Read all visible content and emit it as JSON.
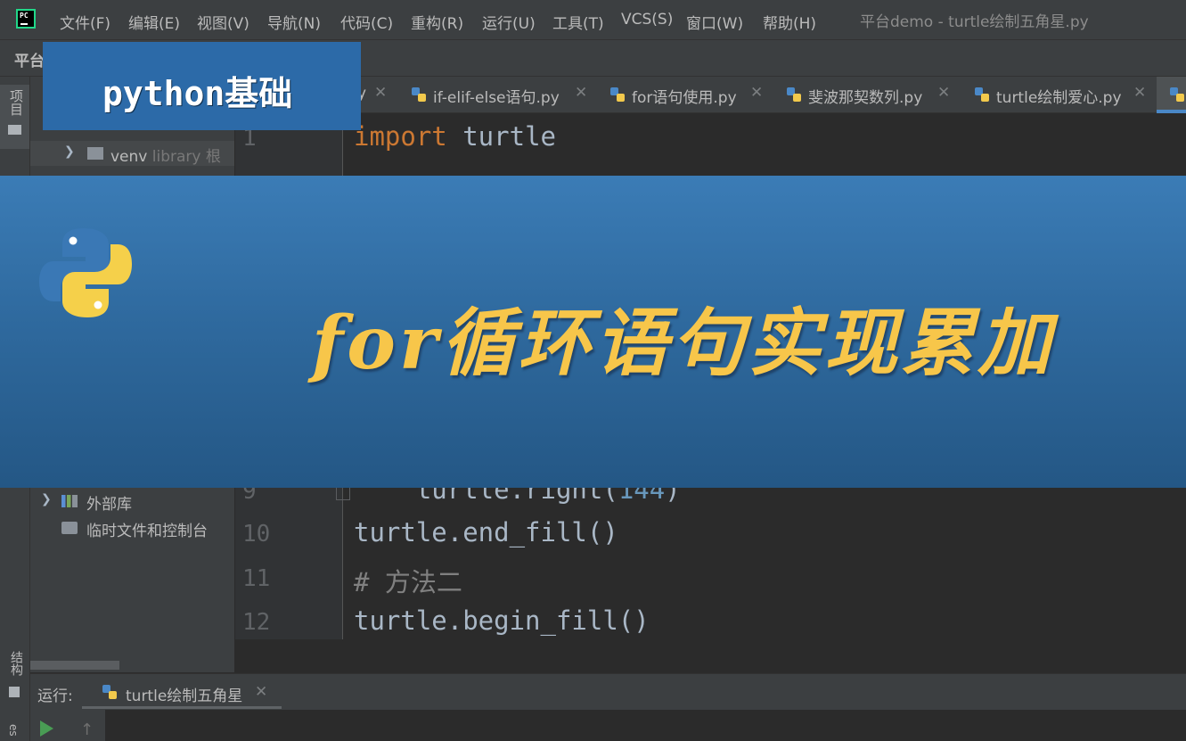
{
  "menubar": {
    "items": [
      "文件(F)",
      "编辑(E)",
      "视图(V)",
      "导航(N)",
      "代码(C)",
      "重构(R)",
      "运行(U)",
      "工具(T)",
      "VCS(S)",
      "窗口(W)",
      "帮助(H)"
    ],
    "window_title": "平台demo - turtle绘制五角星.py"
  },
  "toolbar": {
    "project_name": "平台"
  },
  "left_strip": {
    "project_label": "项目",
    "structure_label": "结构"
  },
  "project_tree": {
    "venv": {
      "name": "venv",
      "hint": "library 根"
    },
    "external_libs": "外部库",
    "scratches": "临时文件和控制台"
  },
  "tabs": [
    {
      "label": "y"
    },
    {
      "label": "if-elif-else语句.py"
    },
    {
      "label": "for语句使用.py"
    },
    {
      "label": "斐波那契数列.py"
    },
    {
      "label": "turtle绘制爱心.py"
    }
  ],
  "editor": {
    "lines": [
      {
        "num": "1",
        "kw": "import",
        "rest": " turtle"
      },
      {
        "num": "9",
        "code": "    turtle.right(",
        "number": "144",
        "close": ")"
      },
      {
        "num": "10",
        "code": "turtle.end_fill()"
      },
      {
        "num": "11",
        "comment": "# 方法二"
      },
      {
        "num": "12",
        "code": "turtle.begin_fill()"
      }
    ]
  },
  "run_panel": {
    "label": "运行:",
    "tab": "turtle绘制五角星"
  },
  "overlay": {
    "badge": "python基础",
    "banner_title": "for循环语句实现累加"
  },
  "colors": {
    "accent_blue": "#2c6aa8",
    "banner_title": "#f7c64a",
    "keyword": "#cc7832",
    "number": "#6897bb",
    "comment": "#808080"
  }
}
